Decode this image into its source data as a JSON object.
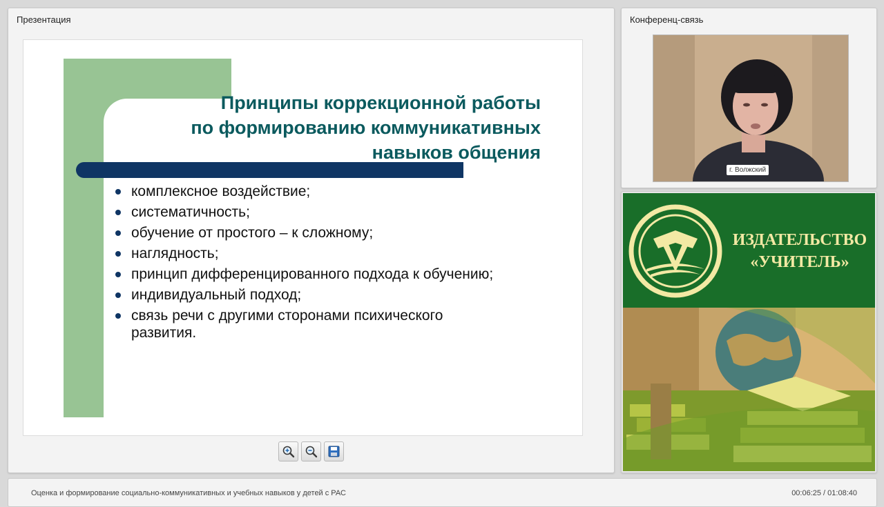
{
  "presentation": {
    "panel_title": "Презентация",
    "slide": {
      "title": "Принципы коррекционной работы\nпо формированию коммуникативных\nнавыков общения",
      "bullets": [
        "комплексное воздействие;",
        "систематичность;",
        "обучение от простого – к сложному;",
        "наглядность;",
        "принцип дифференцированного подхода к обучению;",
        "индивидуальный подход;",
        "связь речи с другими сторонами психического развития."
      ]
    },
    "toolbar": {
      "zoom_in_icon": "zoom-in-icon",
      "zoom_out_icon": "zoom-out-icon",
      "save_icon": "save-icon"
    }
  },
  "conference": {
    "panel_title": "Конференц-связь",
    "webcam_label": "г. Волжский"
  },
  "advert": {
    "line1": "ИЗДАТЕЛЬСТВО",
    "line2": "«УЧИТЕЛЬ»",
    "colors": {
      "green": "#196e29",
      "text": "#f3e9a4"
    }
  },
  "footer": {
    "title": "Оценка и формирование социально-коммуникативных и учебных навыков у детей с РАС",
    "time": "00:06:25 / 01:08:40"
  },
  "colors": {
    "slide_title": "#0b5a5e",
    "slide_bar": "#0f3564",
    "slide_green": "#98c494"
  }
}
